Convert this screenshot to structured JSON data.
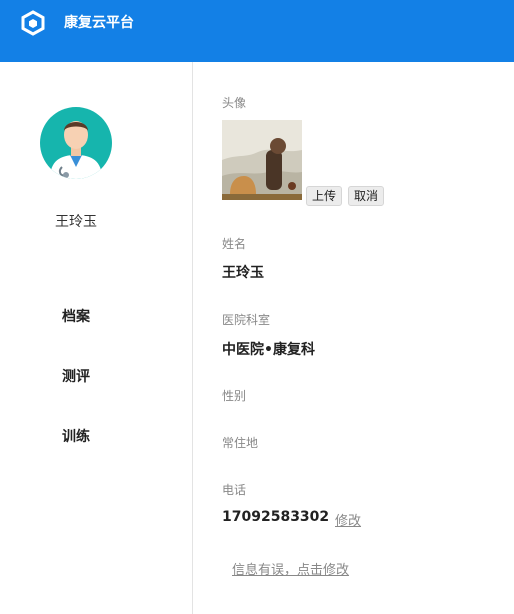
{
  "app": {
    "title": "康复云平台",
    "accent_color": "#1380e6",
    "logo_icon": "hexagon-logo-icon"
  },
  "sidebar": {
    "user_name": "王玲玉",
    "avatar_icon": "doctor-avatar-icon",
    "nav": [
      {
        "label": "档案"
      },
      {
        "label": "测评"
      },
      {
        "label": "训练"
      }
    ]
  },
  "profile": {
    "avatar_label": "头像",
    "upload_label": "上传",
    "cancel_label": "取消",
    "name_label": "姓名",
    "name_value": "王玲玉",
    "dept_label": "医院科室",
    "dept_value": "中医院•康复科",
    "gender_label": "性别",
    "residence_label": "常住地",
    "phone_label": "电话",
    "phone_value": "17092583302",
    "phone_edit_label": "修改",
    "report_error_label": "信息有误，点击修改"
  }
}
